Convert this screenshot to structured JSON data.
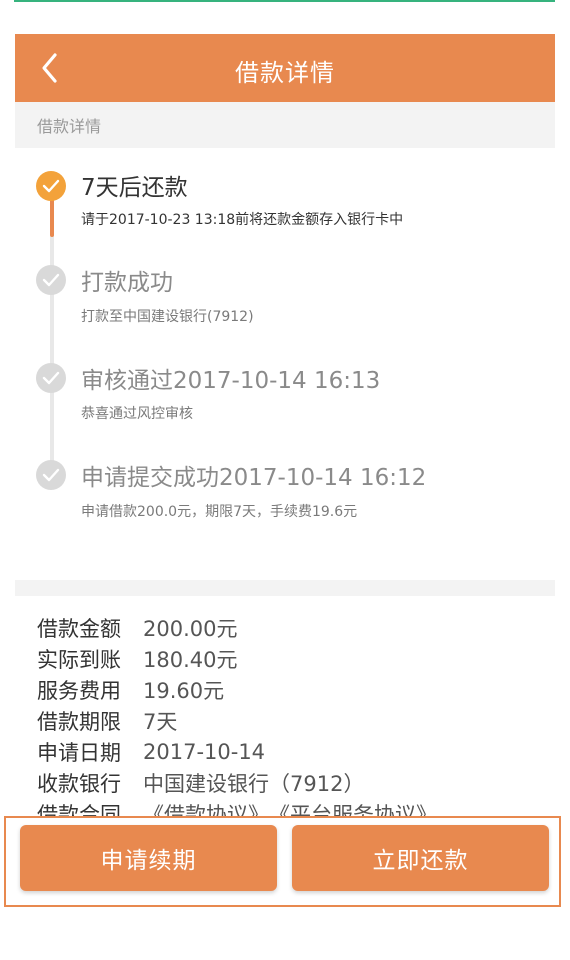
{
  "colors": {
    "accent": "#e8894f",
    "active_dot": "#f3a23a",
    "done_dot": "#d9d9d9",
    "top_line": "#36b37e"
  },
  "header": {
    "title": "借款详情",
    "back_icon": "chevron-left-icon"
  },
  "section": {
    "label": "借款详情"
  },
  "timeline": [
    {
      "title": "7天后还款",
      "desc": "请于2017-10-23 13:18前将还款金额存入银行卡中",
      "status": "active",
      "icon": "check-icon"
    },
    {
      "title": "打款成功",
      "desc": "打款至中国建设银行(7912)",
      "status": "done",
      "icon": "check-icon"
    },
    {
      "title": "审核通过2017-10-14 16:13",
      "desc": "恭喜通过风控审核",
      "status": "done",
      "icon": "check-icon"
    },
    {
      "title": "申请提交成功2017-10-14 16:12",
      "desc": "申请借款200.0元，期限7天，手续费19.6元",
      "status": "done",
      "icon": "check-icon"
    }
  ],
  "details": [
    {
      "label": "借款金额",
      "value": "200.00元"
    },
    {
      "label": "实际到账",
      "value": "180.40元"
    },
    {
      "label": "服务费用",
      "value": "19.60元"
    },
    {
      "label": "借款期限",
      "value": "7天"
    },
    {
      "label": "申请日期",
      "value": "2017-10-14"
    },
    {
      "label": "收款银行",
      "value": "中国建设银行（7912）"
    },
    {
      "label": "借款合同",
      "link1": "《借款协议》",
      "link2": "《平台服务协议》"
    }
  ],
  "buttons": {
    "renew": "申请续期",
    "repay": "立即还款"
  }
}
